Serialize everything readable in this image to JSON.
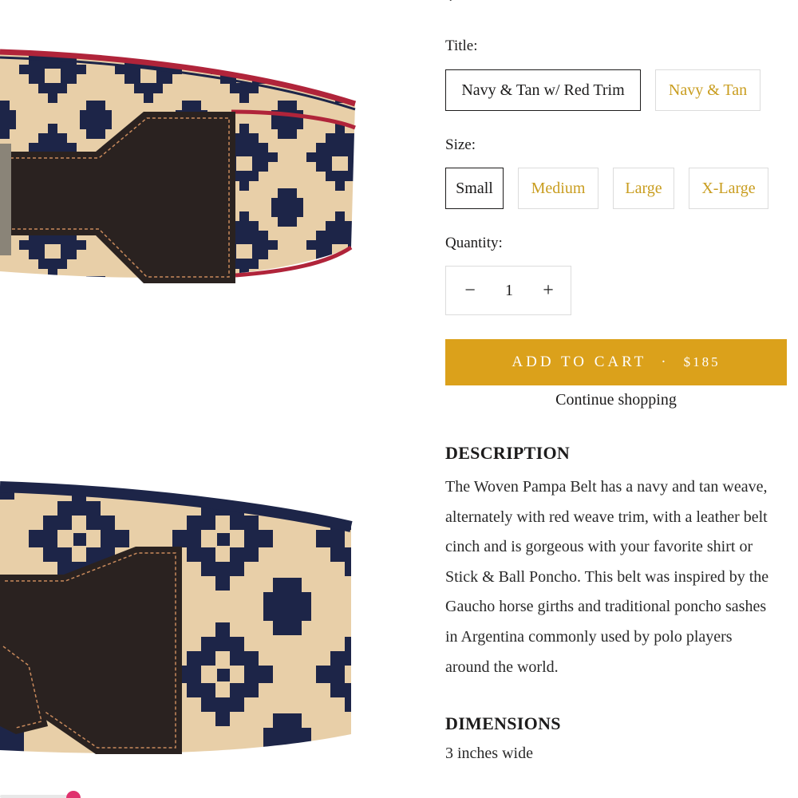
{
  "title_label": "Title:",
  "title_options": [
    {
      "label": "Navy & Tan w/ Red Trim",
      "selected": true
    },
    {
      "label": "Navy & Tan",
      "selected": false
    }
  ],
  "size_label": "Size:",
  "size_options": [
    {
      "label": "Small",
      "selected": true
    },
    {
      "label": "Medium",
      "selected": false
    },
    {
      "label": "Large",
      "selected": false
    },
    {
      "label": "X-Large",
      "selected": false
    }
  ],
  "quantity_label": "Quantity:",
  "quantity": {
    "minus": "−",
    "value": "1",
    "plus": "+"
  },
  "cart": {
    "label": "ADD TO CART",
    "separator": "·",
    "price": "$185"
  },
  "continue_label": "Continue shopping",
  "description": {
    "heading": "DESCRIPTION",
    "lines": [
      "The Woven Pampa Belt has a navy and tan weave,",
      "alternately with red weave trim, with a leather belt",
      "cinch and is gorgeous with your favorite shirt or",
      "Stick & Ball Poncho. This belt was inspired by the",
      "Gaucho horse girths and traditional poncho sashes",
      "in Argentina commonly used by polo players",
      "around the world."
    ]
  },
  "dimensions": {
    "heading": "DIMENSIONS",
    "text": "3 inches wide"
  },
  "colors": {
    "accent": "#dba11b",
    "option_text": "#c99d1f",
    "navy": "#1d2548",
    "tan": "#e8cfa8",
    "red_trim": "#b0243a",
    "leather": "#2a2220"
  }
}
